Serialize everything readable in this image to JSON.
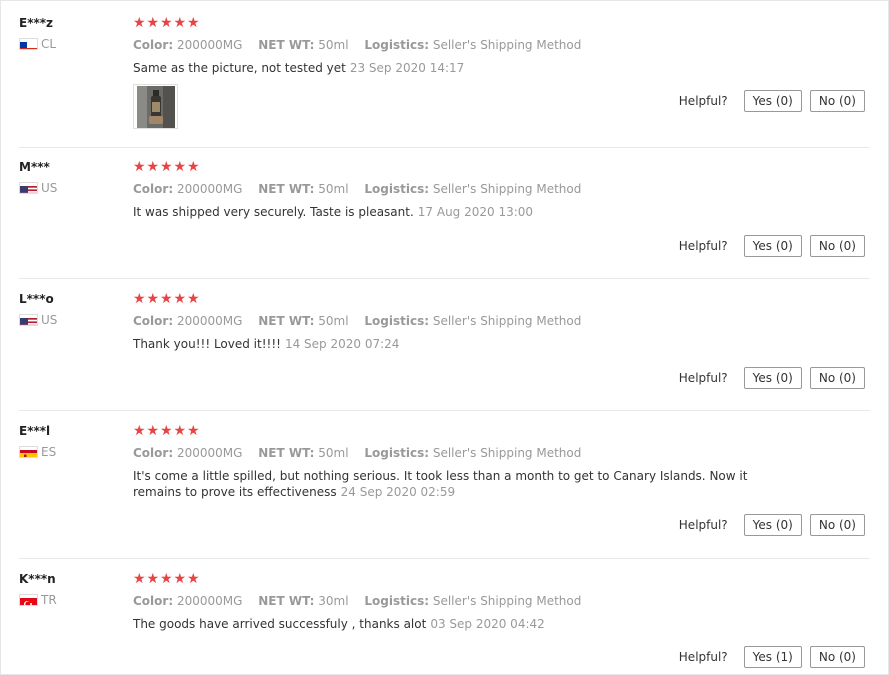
{
  "labels": {
    "color": "Color:",
    "net_wt": "NET WT:",
    "logistics": "Logistics:",
    "helpful": "Helpful?"
  },
  "reviews": [
    {
      "user": "E***z",
      "country": "CL",
      "rating": 5,
      "color": "200000MG",
      "net_wt": "50ml",
      "logistics": "Seller's Shipping Method",
      "text": "Same as the picture, not tested yet",
      "date": "23 Sep 2020 14:17",
      "yes": "Yes (0)",
      "no": "No (0)",
      "has_photo": true
    },
    {
      "user": "M***",
      "country": "US",
      "rating": 5,
      "color": "200000MG",
      "net_wt": "50ml",
      "logistics": "Seller's Shipping Method",
      "text": "It was shipped very securely. Taste is pleasant.",
      "date": "17 Aug 2020 13:00",
      "yes": "Yes (0)",
      "no": "No (0)"
    },
    {
      "user": "L***o",
      "country": "US",
      "rating": 5,
      "color": "200000MG",
      "net_wt": "50ml",
      "logistics": "Seller's Shipping Method",
      "text": "Thank you!!! Loved it!!!!",
      "date": "14 Sep 2020 07:24",
      "yes": "Yes (0)",
      "no": "No (0)"
    },
    {
      "user": "E***l",
      "country": "ES",
      "rating": 5,
      "color": "200000MG",
      "net_wt": "50ml",
      "logistics": "Seller's Shipping Method",
      "text": "It's come a little spilled, but nothing serious. It took less than a month to get to Canary Islands. Now it remains to prove its effectiveness",
      "date": "24 Sep 2020 02:59",
      "yes": "Yes (0)",
      "no": "No (0)"
    },
    {
      "user": "K***n",
      "country": "TR",
      "rating": 5,
      "color": "200000MG",
      "net_wt": "30ml",
      "logistics": "Seller's Shipping Method",
      "text": "The goods have arrived successfuly , thanks alot",
      "date": "03 Sep 2020 04:42",
      "yes": "Yes (1)",
      "no": "No (0)"
    }
  ],
  "colors": {
    "star": "#e64545",
    "muted": "#999999",
    "text": "#333333"
  }
}
